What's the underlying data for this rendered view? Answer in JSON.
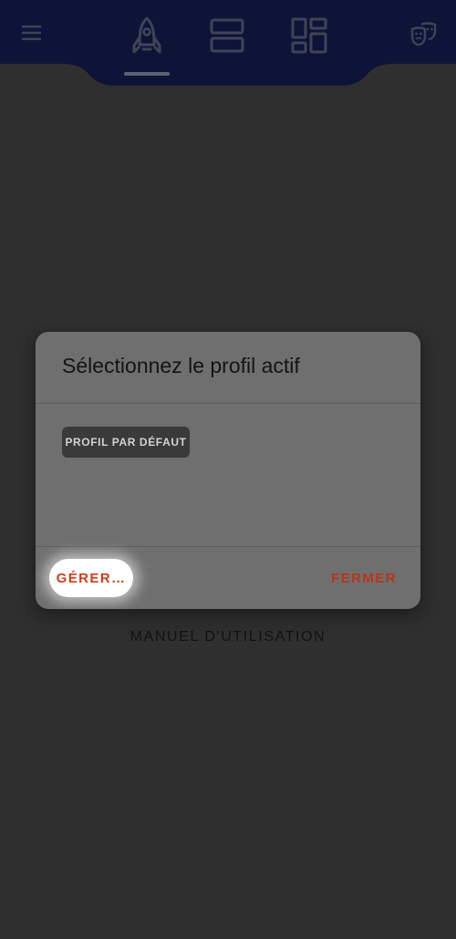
{
  "topbar": {
    "menu_icon": "hamburger-menu-icon",
    "tabs": [
      {
        "icon": "rocket-icon",
        "selected": true
      },
      {
        "icon": "list-rows-icon",
        "selected": false
      },
      {
        "icon": "dashboard-grid-icon",
        "selected": false
      }
    ],
    "theme_icon": "theater-masks-icon"
  },
  "background": {
    "manual_link": "MANUEL D'UTILISATION"
  },
  "dialog": {
    "title": "Sélectionnez le profil actif",
    "profiles": [
      {
        "label": "PROFIL PAR DÉFAUT"
      }
    ],
    "manage_label": "GÉRER…",
    "close_label": "FERMER"
  },
  "colors": {
    "bar": "#0e1438",
    "scrim": "#2f2f2f",
    "dialog": "#6f6f6f",
    "accent": "#c9391b",
    "chip": "#3a3a3a"
  }
}
